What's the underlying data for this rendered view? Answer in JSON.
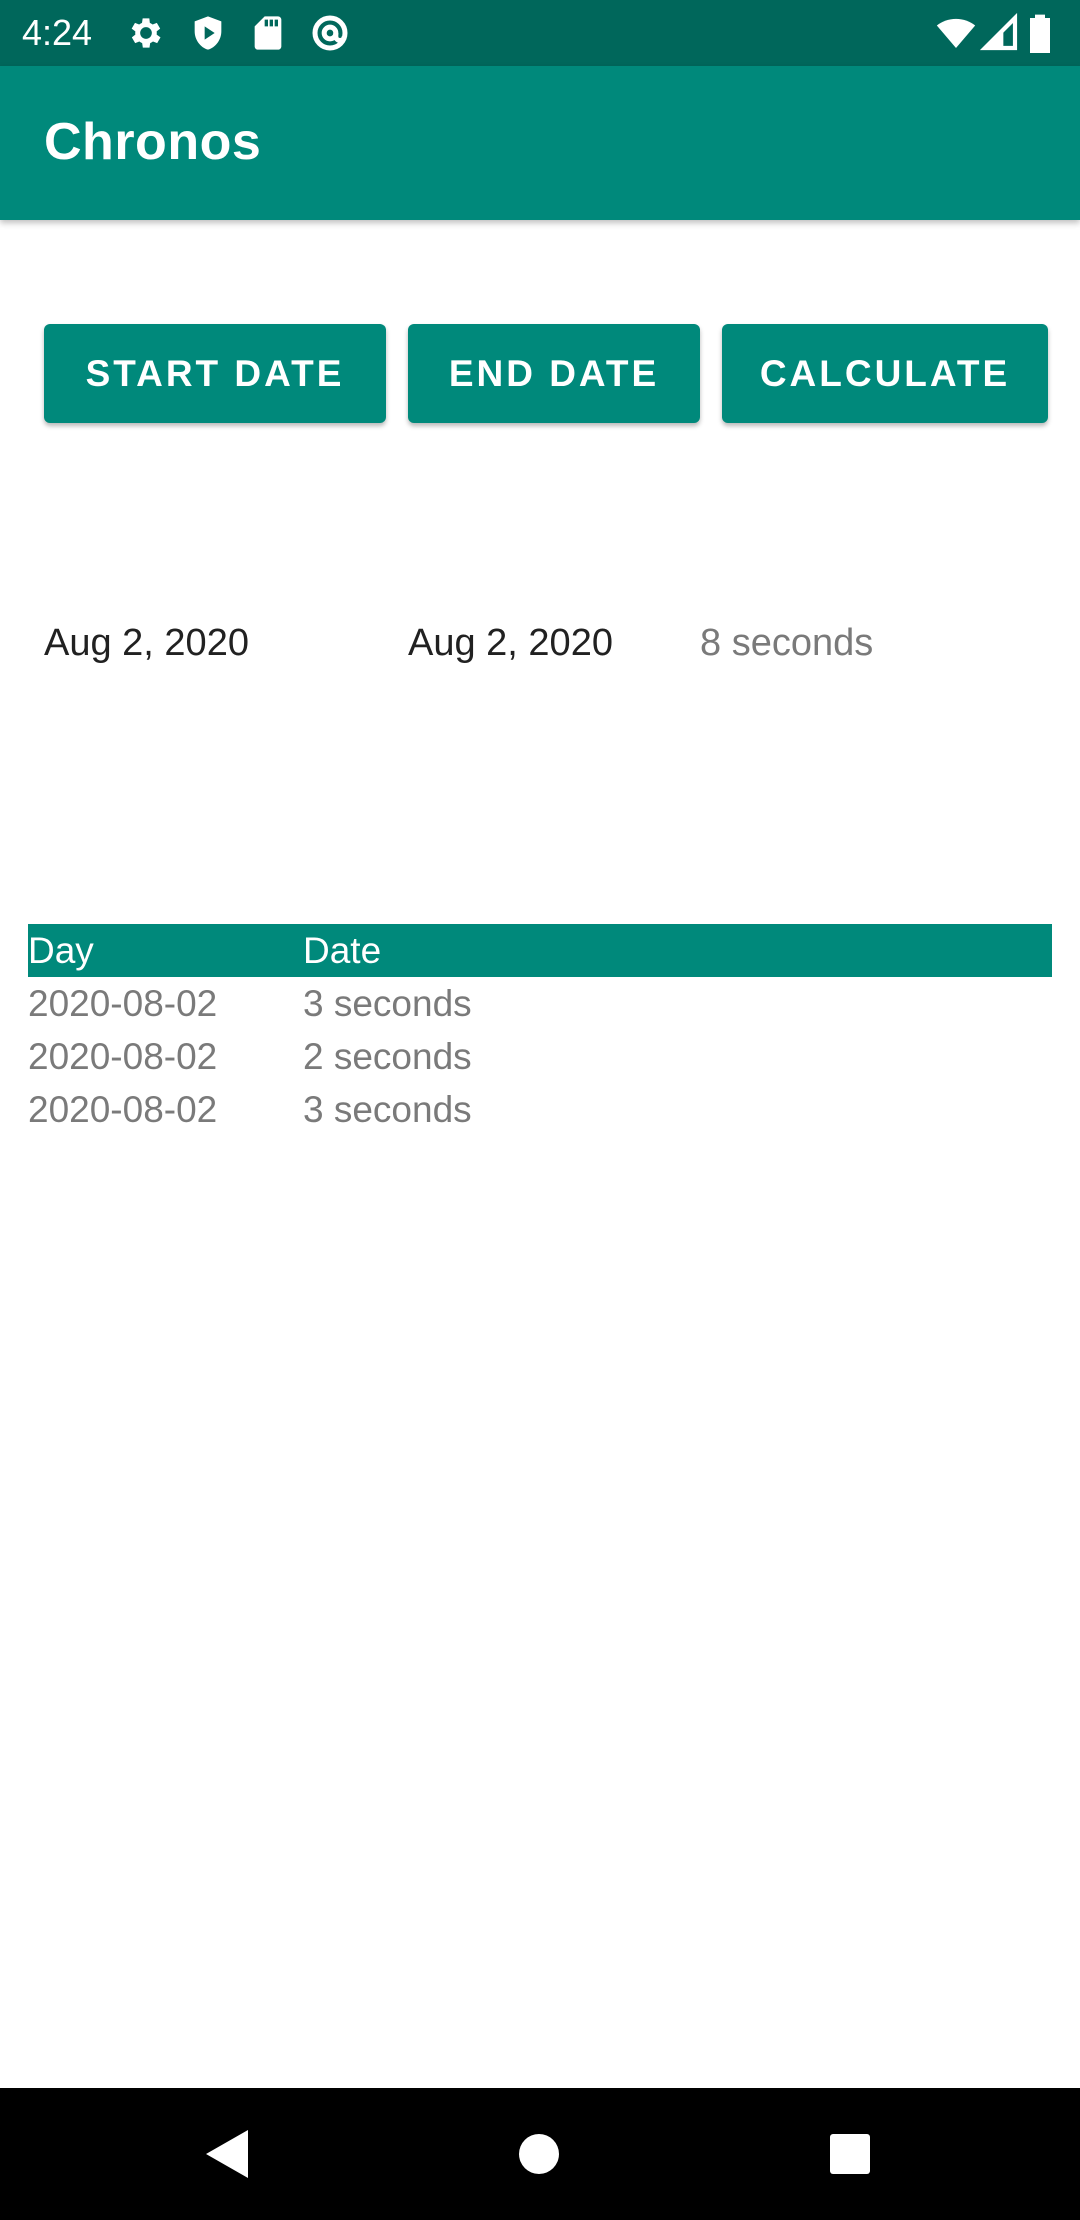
{
  "status_bar": {
    "time": "4:24",
    "left_icons": [
      "settings-icon",
      "shield-icon",
      "sd-card-icon",
      "at-sign-icon"
    ],
    "right_icons": [
      "wifi-icon",
      "cell-signal-icon",
      "battery-icon"
    ]
  },
  "app_bar": {
    "title": "Chronos"
  },
  "buttons": {
    "start_label": "START DATE",
    "end_label": "END DATE",
    "calculate_label": "CALCULATE"
  },
  "result": {
    "start_date": "Aug 2, 2020",
    "end_date": "Aug 2, 2020",
    "total": "8 seconds"
  },
  "table": {
    "headers": [
      "Day",
      "Date"
    ],
    "rows": [
      [
        "2020-08-02",
        "3 seconds"
      ],
      [
        "2020-08-02",
        "2 seconds"
      ],
      [
        "2020-08-02",
        "3 seconds"
      ]
    ]
  },
  "nav_bar": {
    "icons": [
      "back-icon",
      "home-icon",
      "recents-icon"
    ]
  },
  "colors": {
    "primary": "#00897b",
    "primary_dark": "#00675b",
    "text_primary": "#212121",
    "text_secondary": "#7a7a7a"
  }
}
